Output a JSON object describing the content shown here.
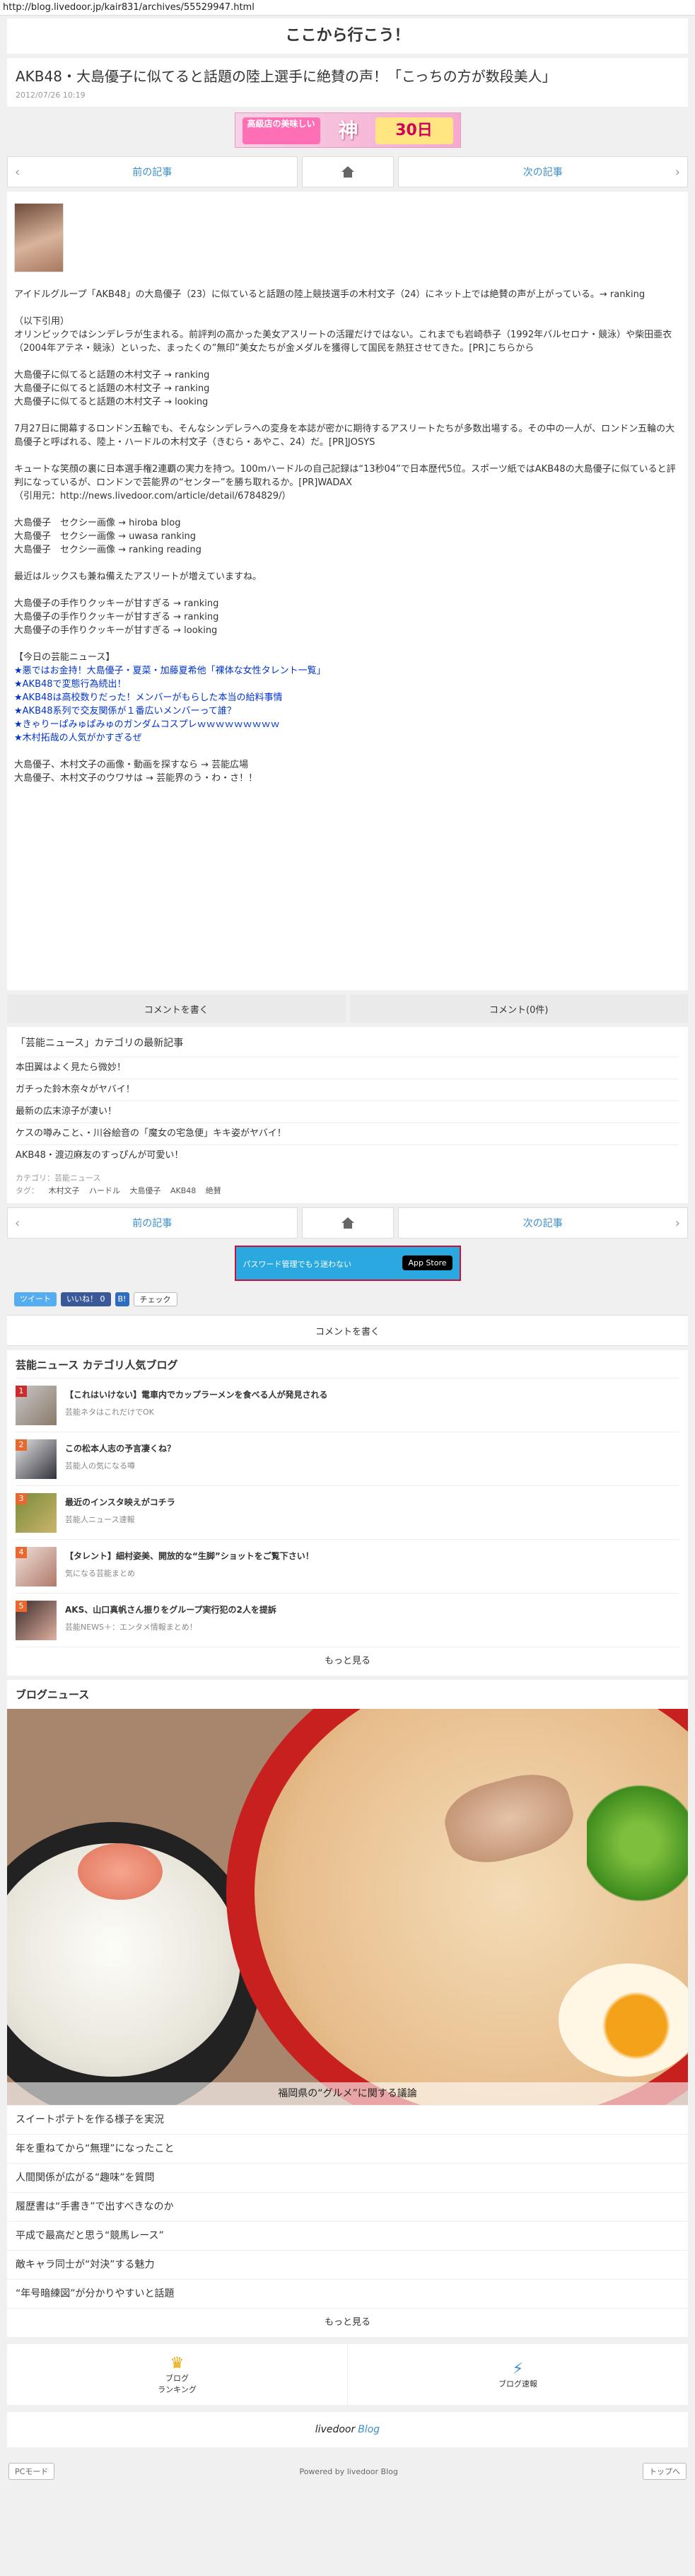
{
  "url": "http://blog.livedoor.jp/kair831/archives/55529947.html",
  "site_title": "ここから行こう！",
  "article": {
    "title": "AKB48・大島優子に似てると話題の陸上選手に絶賛の声！「こっちの方が数段美人」",
    "date": "2012/07/26 10:19"
  },
  "top_banner": {
    "text1": "高級店の美味しい",
    "text2": "神",
    "text3": "30日"
  },
  "pager": {
    "prev": "前の記事",
    "next": "次の記事"
  },
  "body": {
    "lead": "アイドルグループ「AKB48」の大島優子（23）に似ていると話題の陸上競技選手の木村文子（24）にネット上では絶賛の声が上がっている。→ ranking",
    "quote_head": "（以下引用）",
    "quote_p": "オリンピックではシンデレラが生まれる。前評判の高かった美女アスリートの活躍だけではない。これまでも岩崎恭子（1992年バルセロナ・競泳）や柴田亜衣（2004年アテネ・競泳）といった、まったくの”無印”美女たちが金メダルを獲得して国民を熱狂させてきた。[PR]こちらから",
    "links1": [
      "大島優子に似てると話題の木村文子 → ranking",
      "大島優子に似てると話題の木村文子 → ranking",
      "大島優子に似てると話題の木村文子 → looking"
    ],
    "p2": "7月27日に開幕するロンドン五輪でも、そんなシンデレラへの変身を本誌が密かに期待するアスリートたちが多数出場する。その中の一人が、ロンドン五輪の大島優子と呼ばれる、陸上・ハードルの木村文子（きむら・あやこ、24）だ。[PR]JOSYS",
    "p3": "キュートな笑顔の裏に日本選手権2連覇の実力を持つ。100mハードルの自己記録は“13秒04”で日本歴代5位。スポーツ紙ではAKB48の大島優子に似ていると評判になっているが、ロンドンで芸能界の“センター”を勝ち取れるか。[PR]WADAX",
    "cite": "（引用元：http://news.livedoor.com/article/detail/6784829/）",
    "links2": [
      "大島優子　セクシー画像 → hiroba blog",
      "大島優子　セクシー画像 → uwasa ranking",
      "大島優子　セクシー画像 → ranking reading"
    ],
    "p4": "最近はルックスも兼ね備えたアスリートが増えていますね。",
    "links3": [
      "大島優子の手作りクッキーが甘すぎる → ranking",
      "大島優子の手作りクッキーが甘すぎる → ranking",
      "大島優子の手作りクッキーが甘すぎる → looking"
    ],
    "news_head": "【今日の芸能ニュース】",
    "news": [
      "★悪ではお金持！大島優子・夏菜・加藤夏希他「裸体な女性タレント一覧」",
      "★AKB48で変態行為続出！",
      "★AKB48は高校数りだった！メンバーがもらした本当の給料事情",
      "★AKB48系列で交友関係が１番広いメンバーって誰？",
      "★きゃりーぱみゅぱみゅのガンダムコスプレｗｗｗｗｗｗｗｗｗ",
      "★木村拓哉の人気がかすぎるぜ"
    ],
    "tail1": "大島優子、木村文子の画像・動画を探すなら → 芸能広場",
    "tail2": "大島優子、木村文子のウワサは → 芸能界のう・わ・さ！！"
  },
  "comments": {
    "write": "コメントを書く",
    "count": "コメント(0件)"
  },
  "latest": {
    "heading": "「芸能ニュース」カテゴリの最新記事",
    "items": [
      "本田翼はよく見たら微妙！",
      "ガチった鈴木奈々がヤバイ！",
      "最新の広末涼子が凄い！",
      "ケスの噂みこと、・川谷絵音の「魔女の宅急便」キキ姿がヤバイ！",
      "AKB48・渡辺麻友のすっぴんが可愛い！"
    ],
    "category_label": "カテゴリ：",
    "category": "芸能ニュース",
    "tags_label": "タグ：",
    "tags": [
      "木村文子",
      "ハードル",
      "大島優子",
      "AKB48",
      "絶賛"
    ]
  },
  "mid_banner": {
    "text": "パスワード管理でもう迷わない",
    "store": "App Store"
  },
  "social": {
    "tweet": "ツイート",
    "like": "いいね！ 0",
    "check": "チェック"
  },
  "comment_write2": "コメントを書く",
  "ranking": {
    "heading": "芸能ニュース カテゴリ人気ブログ",
    "items": [
      {
        "num": "1",
        "title": "【これはいけない】電車内でカップラーメンを食べる人が発見される",
        "blog": "芸能ネタはこれだけでOK"
      },
      {
        "num": "2",
        "title": "この松本人志の予言凄くね？",
        "blog": "芸能人の気になる噂"
      },
      {
        "num": "3",
        "title": "最近のインスタ映えがコチラ",
        "blog": "芸能人ニュース速報"
      },
      {
        "num": "4",
        "title": "【タレント】細村姿美、開放的な“生脚”ショットをご覧下さい！",
        "blog": "気になる芸能まとめ"
      },
      {
        "num": "5",
        "title": "AKS、山口真帆さん振りをグループ実行犯の2人を提訴",
        "blog": "芸能NEWS＋：エンタメ情報まとめ！"
      }
    ],
    "more": "もっと見る"
  },
  "blog_news": {
    "heading": "ブログニュース",
    "caption": "福岡県の“グルメ”に関する議論",
    "items": [
      "スイートポテトを作る様子を実況",
      "年を重ねてから“無理”になったこと",
      "人間関係が広がる“趣味”を質問",
      "履歴書は“手書き”で出すべきなのか",
      "平成で最高だと思う“競馬レース”",
      "敵キャラ同士が“対決”する魅力",
      "“年号暗練図”が分かりやすいと話題"
    ],
    "more": "もっと見る"
  },
  "footer_nav": {
    "rank_label1": "ブログ",
    "rank_label2": "ランキング",
    "speed": "ブログ速報"
  },
  "logo": {
    "live": "livedoor",
    "blog": "Blog"
  },
  "bottom": {
    "pc": "PCモード",
    "powered": "Powered by livedoor Blog",
    "top": "トップへ"
  },
  "colors": {
    "link_blue": "#3a8fd0",
    "rank_orange": "#e8682f"
  }
}
